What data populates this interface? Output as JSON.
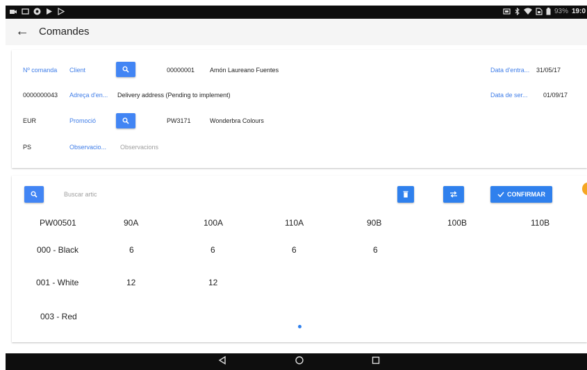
{
  "status_bar": {
    "battery": "93%",
    "time": "19:0"
  },
  "app_bar": {
    "title": "Comandes"
  },
  "order": {
    "order_number_label": "Nº comanda",
    "client_label": "Client",
    "client_code": "00000001",
    "client_name": "Amón Laureano Fuentes",
    "entry_date_label": "Data d'entra...",
    "entry_date": "31/05/17",
    "order_number": "0000000043",
    "address_label": "Adreça d'en...",
    "address_value": "Delivery address (Pending to implement)",
    "service_date_label": "Data de ser...",
    "service_date": "01/09/17",
    "currency": "EUR",
    "promotion_label": "Promoció",
    "promotion_code": "PW3171",
    "promotion_name": "Wonderbra Colours",
    "ps": "PS",
    "observations_label": "Observacio...",
    "observations_placeholder": "Observacions"
  },
  "articles": {
    "search_placeholder": "Buscar artic",
    "confirm_label": "CONFIRMAR",
    "grid": {
      "columns": [
        "PW00501",
        "90A",
        "100A",
        "110A",
        "90B",
        "100B",
        "110B"
      ],
      "rows": [
        {
          "label": "000 - Black",
          "values": [
            "6",
            "6",
            "6",
            "6",
            "",
            ""
          ]
        },
        {
          "label": "001 - White",
          "values": [
            "12",
            "12",
            "",
            "",
            "",
            ""
          ]
        },
        {
          "label": "003 - Red",
          "values": [
            "",
            "",
            "",
            "",
            "",
            ""
          ]
        }
      ]
    }
  },
  "icons": {
    "back": "arrow-left-icon",
    "search": "search-icon",
    "delete": "trash-icon",
    "swap": "swap-icon",
    "confirm": "check-icon"
  },
  "colors": {
    "accent": "#4285f4",
    "label_blue": "#3f7de8",
    "placeholder": "#9e9e9e"
  }
}
